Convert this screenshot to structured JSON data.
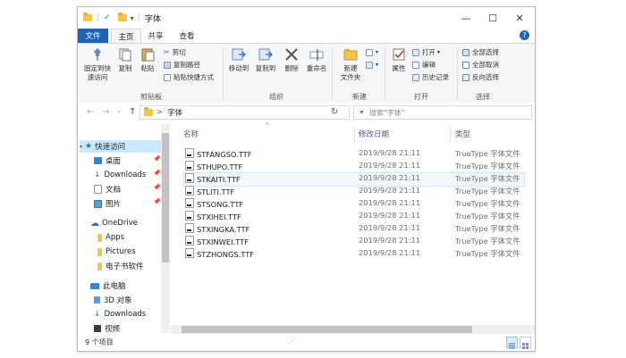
{
  "window": {
    "title": "字体",
    "minimize_glyph": "—",
    "maximize_glyph": "☐",
    "close_glyph": "✕",
    "qa_separator": "|",
    "qa_dropdown": "▾",
    "qa_check": "✓"
  },
  "ribbon_tabs": [
    "文件",
    "主页",
    "共享",
    "查看"
  ],
  "help_label": "?",
  "ribbon": {
    "clipboard": {
      "label": "剪贴板",
      "pin": "固定到快\n速访问",
      "copy": "复制",
      "paste": "粘贴",
      "cut": "剪切",
      "copy_path": "复制路径",
      "paste_shortcut": "粘贴快捷方式"
    },
    "organize": {
      "label": "组织",
      "move_to": "移动到",
      "copy_to": "复制到",
      "delete": "删除",
      "rename": "重命名"
    },
    "new": {
      "label": "新建",
      "new_folder": "新建\n文件夹"
    },
    "open": {
      "label": "打开",
      "properties": "属性",
      "open": "打开",
      "edit": "编辑",
      "history": "历史记录"
    },
    "select": {
      "label": "选择",
      "select_all": "全部选择",
      "select_none": "全部取消",
      "invert": "反向选择"
    }
  },
  "address": {
    "back_glyph": "←",
    "forward_glyph": "→",
    "recent_glyph": "⌄",
    "up_glyph": "↑",
    "path_separator": ">",
    "current": "字体",
    "dropdown_glyph": "⌄",
    "refresh_glyph": "↻",
    "search_placeholder": "搜索\"字体\"",
    "search_glyph": "⌕"
  },
  "nav": {
    "quick_access": "快速访问",
    "desktop": "桌面",
    "downloads": "Downloads",
    "documents": "文档",
    "pictures": "图片",
    "onedrive": "OneDrive",
    "apps": "Apps",
    "pictures_en": "Pictures",
    "ebooks": "电子书软件",
    "this_pc": "此电脑",
    "objects3d": "3D 对象",
    "pc_downloads": "Downloads",
    "videos": "视频",
    "pin_glyph": "📌",
    "expand_glyph": "▸"
  },
  "columns": {
    "name": "名称",
    "modified": "修改日期",
    "type": "类型",
    "sort_glyph": "^"
  },
  "files": [
    {
      "name": "STFANGSO.TTF",
      "date": "2019/9/28 21:11",
      "type": "TrueType 字体文件"
    },
    {
      "name": "STHUPO.TTF",
      "date": "2019/9/28 21:11",
      "type": "TrueType 字体文件"
    },
    {
      "name": "STKAITI.TTF",
      "date": "2019/9/28 21:11",
      "type": "TrueType 字体文件"
    },
    {
      "name": "STLITI.TTF",
      "date": "2019/9/28 21:11",
      "type": "TrueType 字体文件"
    },
    {
      "name": "STSONG.TTF",
      "date": "2019/9/28 21:11",
      "type": "TrueType 字体文件"
    },
    {
      "name": "STXIHEI.TTF",
      "date": "2019/9/28 21:11",
      "type": "TrueType 字体文件"
    },
    {
      "name": "STXINGKA.TTF",
      "date": "2019/9/28 21:11",
      "type": "TrueType 字体文件"
    },
    {
      "name": "STXINWEI.TTF",
      "date": "2019/9/28 21:11",
      "type": "TrueType 字体文件"
    },
    {
      "name": "STZHONGS.TTF",
      "date": "2019/9/28 21:11",
      "type": "TrueType 字体文件"
    }
  ],
  "status": {
    "item_count": "9 个项目"
  },
  "colors": {
    "file_tab": "#1f63b8",
    "folder": "#f0c64c",
    "selection": "#cde8ff",
    "column_header": "#4d6185"
  }
}
